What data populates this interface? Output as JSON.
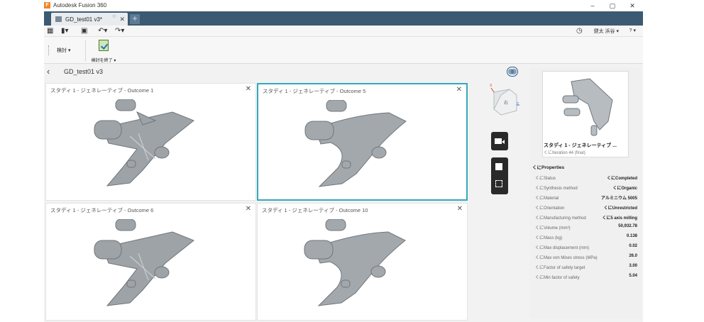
{
  "app": {
    "title": "Autodesk Fusion 360"
  },
  "tab": {
    "name": "GD_test01 v3*",
    "pin": "☆",
    "close": "✕",
    "new": "+"
  },
  "qab": {
    "user": "健太 浜谷 ▾",
    "help": "? ▾"
  },
  "ribbon": {
    "review_dropdown": "検討 ▾",
    "finish_label": "検討を終了 ▾"
  },
  "view": {
    "back": "‹",
    "file_name": "GD_test01 v3"
  },
  "outcomes": [
    {
      "title": "スタディ 1 - ジェネレーティブ - Outcome 1",
      "close": "✕"
    },
    {
      "title": "スタディ 1 - ジェネレーティブ - Outcome 5",
      "close": "✕"
    },
    {
      "title": "スタディ 1 - ジェネレーティブ - Outcome 6",
      "close": "✕"
    },
    {
      "title": "スタディ 1 - ジェネレーティブ - Outcome 10",
      "close": "✕"
    }
  ],
  "viewcube": {
    "label": "右",
    "axis_x": "X",
    "axis_z": "Z"
  },
  "details": {
    "study_name": "スタディ 1 - ジェネレーティブ ...",
    "iteration": "くにIteration 44 (final)",
    "properties_heading": "くにProperties",
    "properties": [
      {
        "key": "くにStatus",
        "value": "くにCompleted"
      },
      {
        "key": "くにSynthesis method",
        "value": "くにOrganic"
      },
      {
        "key": "くにMaterial",
        "value": "アルミニウム 5005"
      },
      {
        "key": "くにOrientation",
        "value": "くにUnrestricted"
      },
      {
        "key": "くにManufacturing method",
        "value": "くに5 axis milling"
      },
      {
        "key": "くにVolume (mm³)",
        "value": "50,932.78"
      },
      {
        "key": "くにMass (kg)",
        "value": "0.138"
      },
      {
        "key": "くにMax displacement (mm)",
        "value": "0.02"
      },
      {
        "key": "くにMax von Mises stress (MPa)",
        "value": "26.0"
      },
      {
        "key": "くにFactor of safety target",
        "value": "3.00"
      },
      {
        "key": "くにMin factor of safety",
        "value": "5.04"
      }
    ]
  },
  "colors": {
    "tabbar": "#3c5a73",
    "selected_border": "#35a8bd",
    "model": "#9ea3a7"
  }
}
